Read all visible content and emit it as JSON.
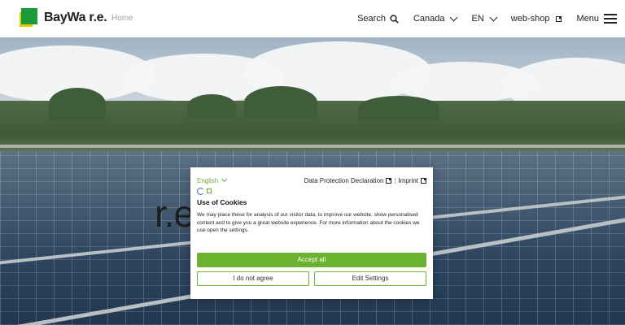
{
  "header": {
    "logo_text": "BayWa r.e.",
    "breadcrumb": "Home",
    "nav": {
      "search_label": "Search",
      "country_label": "Canada",
      "language_label": "EN",
      "webshop_label": "web-shop",
      "menu_label": "Menu"
    }
  },
  "hero": {
    "headline": "r.e. energy"
  },
  "cookie_dialog": {
    "language_select": "English",
    "data_protection_link": "Data Protection Declaration",
    "separator": "|",
    "imprint_link": "Imprint",
    "title": "Use of Cookies",
    "body": "We may place these for analysis of our visitor data, to improve our website, show personalised content and to give you a great website experience. For more information about the cookies we use open the settings.",
    "accept_label": "Accept all",
    "decline_label": "I do not agree",
    "settings_label": "Edit Settings"
  },
  "colors": {
    "brand_green": "#1a9b3b",
    "brand_yellow": "#e7c900",
    "accept_green": "#6bb22e",
    "link_green": "#6aa93a"
  },
  "icons": [
    "search-icon",
    "chevron-down-icon",
    "external-link-icon",
    "hamburger-menu-icon",
    "cookie-consent-logo-icon"
  ]
}
